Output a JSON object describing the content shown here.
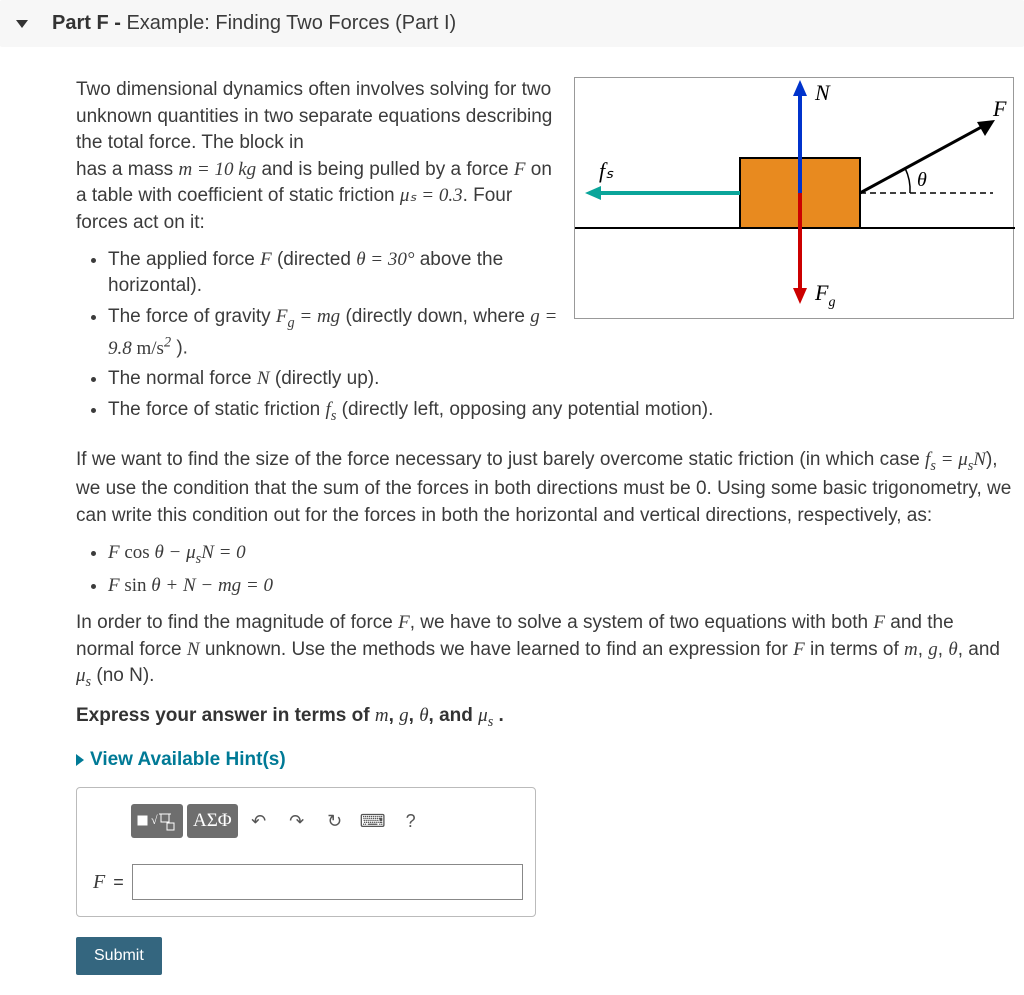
{
  "header": {
    "part_label": "Part F - ",
    "title": "Example: Finding Two Forces (Part I)"
  },
  "intro_text": "Two dimensional dynamics often involves solving for two unknown quantities in two separate equations describing the total force. The block in",
  "intro_mass_pre": "has a mass ",
  "mass_expr": "m = 10 kg",
  "intro_mass_post": " and is being pulled by a force ",
  "force_sym": "F",
  "intro_table_pre": " on a table with coefficient of static friction ",
  "mu_expr": "μₛ = 0.3",
  "intro_end": ". Four forces act on it:",
  "bullets1": [
    {
      "pre": "The applied force ",
      "sym": "F",
      "mid": " (directed ",
      "eq": "θ = 30°",
      "post": " above the horizontal)."
    },
    {
      "pre": "The force of gravity ",
      "eq": "F_g = mg",
      "mid": " (directly down, where ",
      "eq2": "g = 9.8 m/s²",
      "post": " )."
    },
    {
      "pre": "The normal force ",
      "sym": "N",
      "post": " (directly up)."
    },
    {
      "pre": "The force of static friction ",
      "sym": "fₛ",
      "post": " (directly left, opposing any potential motion)."
    }
  ],
  "para2_pre": "If we want to find the size of the force necessary to just barely overcome static friction (in which case ",
  "para2_eq": "fₛ = μₛN",
  "para2_post": "), we use the condition that the sum of the forces in both directions must be 0. Using some basic trigonometry, we can write this condition out for the forces in both the horizontal and vertical directions, respectively, as:",
  "equation1": "F cos θ − μₛN = 0",
  "equation2": "F sin θ + N − mg = 0",
  "para3_pre": "In order to find the magnitude of force ",
  "para3_F": "F",
  "para3_mid1": ", we have to solve a system of two equations with both ",
  "para3_and": " and the normal force ",
  "para3_N": "N",
  "para3_mid2": " unknown. Use the methods we have learned to find an expression for ",
  "para3_mid3": " in terms of ",
  "para3_vars": "m, g, θ, and μₛ",
  "para3_post": " (no N).",
  "express_pre": "Express your answer in terms of ",
  "express_vars": "m, g, θ, and μₛ",
  "express_post": " .",
  "hints_label": "View Available Hint(s)",
  "toolbar": {
    "greek": "ΑΣΦ",
    "undo": "↶",
    "redo": "↷",
    "reset": "↻",
    "keyboard": "⌨",
    "help": "?"
  },
  "answer_lhs": "F",
  "answer_eq": "=",
  "submit_label": "Submit",
  "figure": {
    "N_label": "N",
    "F_label": "F",
    "fs_label": "fₛ",
    "Fg_label": "F",
    "Fg_sub": "g",
    "theta_label": "θ"
  }
}
